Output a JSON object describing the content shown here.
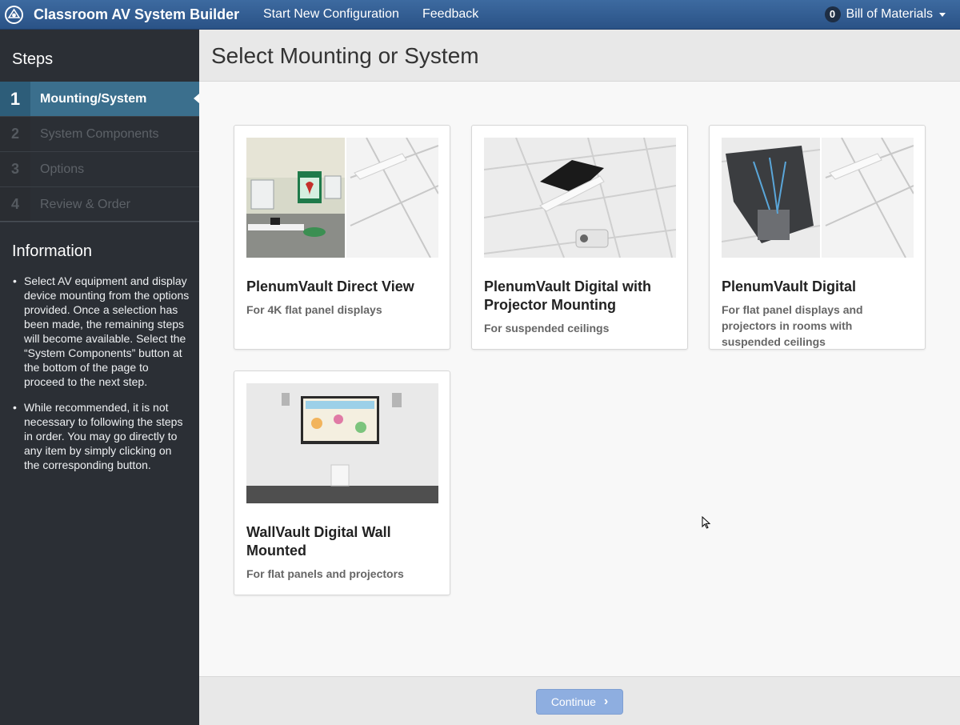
{
  "navbar": {
    "brand": "Classroom AV System Builder",
    "links": [
      "Start New Configuration",
      "Feedback"
    ],
    "bom_count": "0",
    "bom_label": "Bill of Materials"
  },
  "sidebar": {
    "steps_title": "Steps",
    "steps": [
      {
        "num": "1",
        "label": "Mounting/System"
      },
      {
        "num": "2",
        "label": "System Components"
      },
      {
        "num": "3",
        "label": "Options"
      },
      {
        "num": "4",
        "label": "Review & Order"
      }
    ],
    "info_title": "Information",
    "info_items": [
      "Select AV equipment and display device mounting from the options provided. Once a selection has been made, the remaining steps will become available. Select the “System Components” button at the bottom of the page to proceed to the next step.",
      "While recommended, it is not necessary to following the steps in order. You may go directly to any item by simply clicking on the corresponding button."
    ]
  },
  "main": {
    "title": "Select Mounting or System",
    "cards": [
      {
        "title": "PlenumVault Direct View",
        "desc": "For 4K flat panel displays"
      },
      {
        "title": "PlenumVault Digital with Projector Mounting",
        "desc": "For suspended ceilings"
      },
      {
        "title": "PlenumVault Digital",
        "desc": "For flat panel displays and projectors in rooms with suspended ceilings"
      },
      {
        "title": "WallVault Digital Wall Mounted",
        "desc": "For flat panels and projectors"
      }
    ]
  },
  "footer": {
    "continue_label": "Continue"
  },
  "colors": {
    "navbar": "#2f5a8e",
    "sidebar": "#2b2f35",
    "active_step": "#3b6f8d",
    "continue_button": "#8eaee0"
  }
}
